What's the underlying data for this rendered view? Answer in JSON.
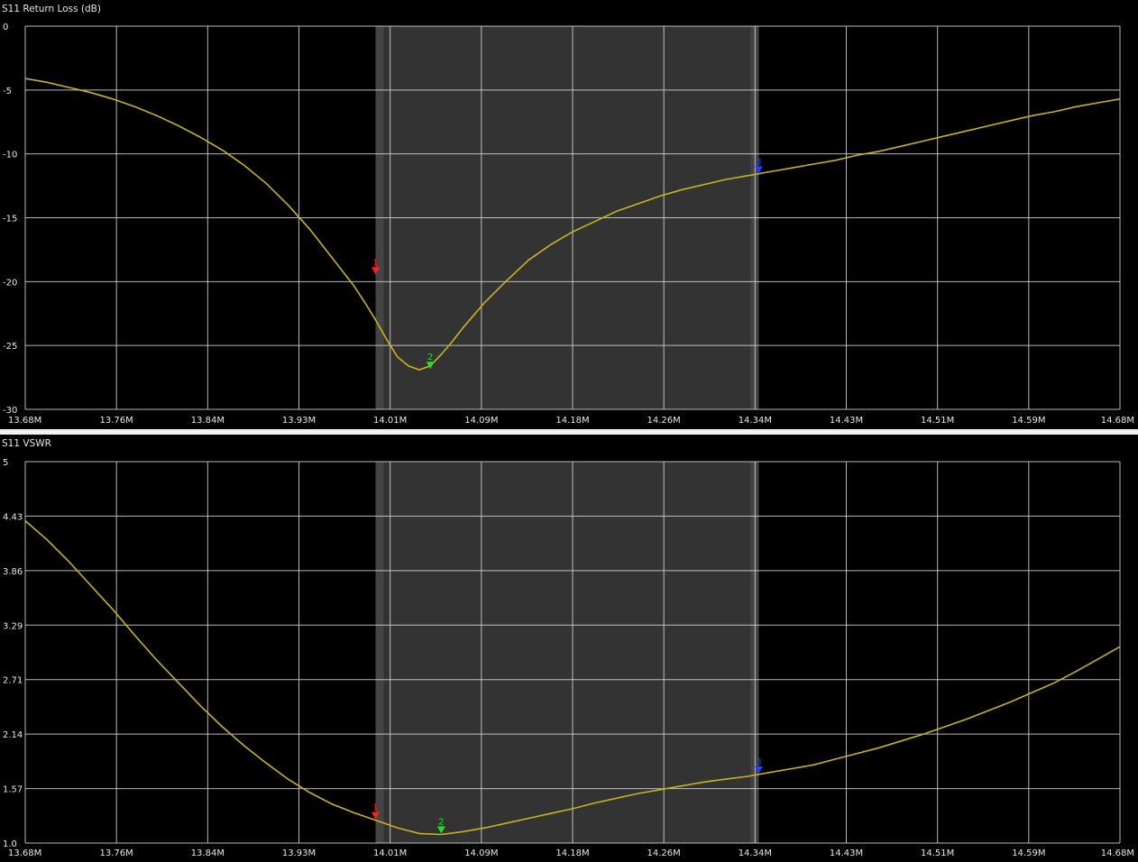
{
  "chart_data": [
    {
      "type": "line",
      "title": "S11 Return Loss (dB)",
      "x_ticks": [
        "13.68M",
        "13.76M",
        "13.84M",
        "13.93M",
        "14.01M",
        "14.09M",
        "14.18M",
        "14.26M",
        "14.34M",
        "14.43M",
        "14.51M",
        "14.59M",
        "14.68M"
      ],
      "y_ticks": [
        "0",
        "-5",
        "-10",
        "-15",
        "-20",
        "-25",
        "-30"
      ],
      "xlim": [
        13.68,
        14.68
      ],
      "ylim": [
        -30,
        0
      ],
      "highlight_band": [
        14.0,
        14.35
      ],
      "grid": true,
      "series": [
        {
          "x": [
            13.68,
            13.7,
            13.72,
            13.74,
            13.76,
            13.78,
            13.8,
            13.82,
            13.84,
            13.86,
            13.88,
            13.9,
            13.92,
            13.94,
            13.96,
            13.98,
            13.99,
            14.0,
            14.01,
            14.02,
            14.03,
            14.04,
            14.05,
            14.06,
            14.07,
            14.08,
            14.09,
            14.1,
            14.12,
            14.14,
            14.16,
            14.18,
            14.2,
            14.22,
            14.24,
            14.26,
            14.28,
            14.3,
            14.32,
            14.34,
            14.36,
            14.38,
            14.4,
            14.42,
            14.44,
            14.46,
            14.48,
            14.5,
            14.52,
            14.54,
            14.56,
            14.58,
            14.6,
            14.62,
            14.64,
            14.66,
            14.68
          ],
          "y": [
            -4.1,
            -4.4,
            -4.8,
            -5.2,
            -5.7,
            -6.3,
            -7.0,
            -7.8,
            -8.7,
            -9.7,
            -10.9,
            -12.3,
            -14.0,
            -15.9,
            -18.1,
            -20.3,
            -21.6,
            -23.0,
            -24.5,
            -25.9,
            -26.6,
            -26.9,
            -26.6,
            -25.7,
            -24.7,
            -23.6,
            -22.6,
            -21.6,
            -19.9,
            -18.3,
            -17.1,
            -16.1,
            -15.3,
            -14.5,
            -13.9,
            -13.3,
            -12.8,
            -12.4,
            -12.0,
            -11.7,
            -11.4,
            -11.1,
            -10.8,
            -10.5,
            -10.1,
            -9.8,
            -9.4,
            -9.0,
            -8.6,
            -8.2,
            -7.8,
            -7.4,
            -7.0,
            -6.7,
            -6.3,
            -6.0,
            -5.7
          ]
        }
      ],
      "markers": [
        {
          "label": "1",
          "x": 14.0,
          "y": -19.5,
          "color": "#ff2020"
        },
        {
          "label": "2",
          "x": 14.05,
          "y": -26.9,
          "color": "#20e020"
        },
        {
          "label": "3",
          "x": 14.35,
          "y": -11.6,
          "color": "#2040ff"
        }
      ]
    },
    {
      "type": "line",
      "title": "S11 VSWR",
      "x_ticks": [
        "13.68M",
        "13.76M",
        "13.84M",
        "13.93M",
        "14.01M",
        "14.09M",
        "14.18M",
        "14.26M",
        "14.34M",
        "14.43M",
        "14.51M",
        "14.59M",
        "14.68M"
      ],
      "y_ticks": [
        "5",
        "4.43",
        "3.86",
        "3.29",
        "2.71",
        "2.14",
        "1.57",
        "1.0"
      ],
      "xlim": [
        13.68,
        14.68
      ],
      "ylim": [
        1.0,
        5.0
      ],
      "highlight_band": [
        14.0,
        14.35
      ],
      "grid": true,
      "series": [
        {
          "x": [
            13.68,
            13.7,
            13.72,
            13.74,
            13.76,
            13.78,
            13.8,
            13.82,
            13.84,
            13.86,
            13.88,
            13.9,
            13.92,
            13.94,
            13.96,
            13.98,
            14.0,
            14.02,
            14.04,
            14.06,
            14.08,
            14.1,
            14.12,
            14.14,
            14.16,
            14.18,
            14.2,
            14.22,
            14.24,
            14.26,
            14.28,
            14.3,
            14.32,
            14.34,
            14.36,
            14.38,
            14.4,
            14.42,
            14.44,
            14.46,
            14.48,
            14.5,
            14.52,
            14.54,
            14.56,
            14.58,
            14.6,
            14.62,
            14.64,
            14.66,
            14.68
          ],
          "y": [
            4.38,
            4.18,
            3.95,
            3.7,
            3.45,
            3.18,
            2.92,
            2.68,
            2.44,
            2.22,
            2.02,
            1.84,
            1.67,
            1.53,
            1.41,
            1.32,
            1.24,
            1.16,
            1.1,
            1.09,
            1.12,
            1.16,
            1.21,
            1.26,
            1.31,
            1.36,
            1.42,
            1.47,
            1.52,
            1.56,
            1.6,
            1.64,
            1.67,
            1.7,
            1.74,
            1.78,
            1.82,
            1.88,
            1.94,
            2.0,
            2.07,
            2.14,
            2.22,
            2.3,
            2.39,
            2.48,
            2.58,
            2.68,
            2.8,
            2.93,
            3.06
          ]
        }
      ],
      "markers": [
        {
          "label": "1",
          "x": 14.0,
          "y": 1.24,
          "color": "#ff2020"
        },
        {
          "label": "2",
          "x": 14.06,
          "y": 1.09,
          "color": "#20e020"
        },
        {
          "label": "3",
          "x": 14.35,
          "y": 1.72,
          "color": "#2040ff"
        }
      ]
    }
  ]
}
